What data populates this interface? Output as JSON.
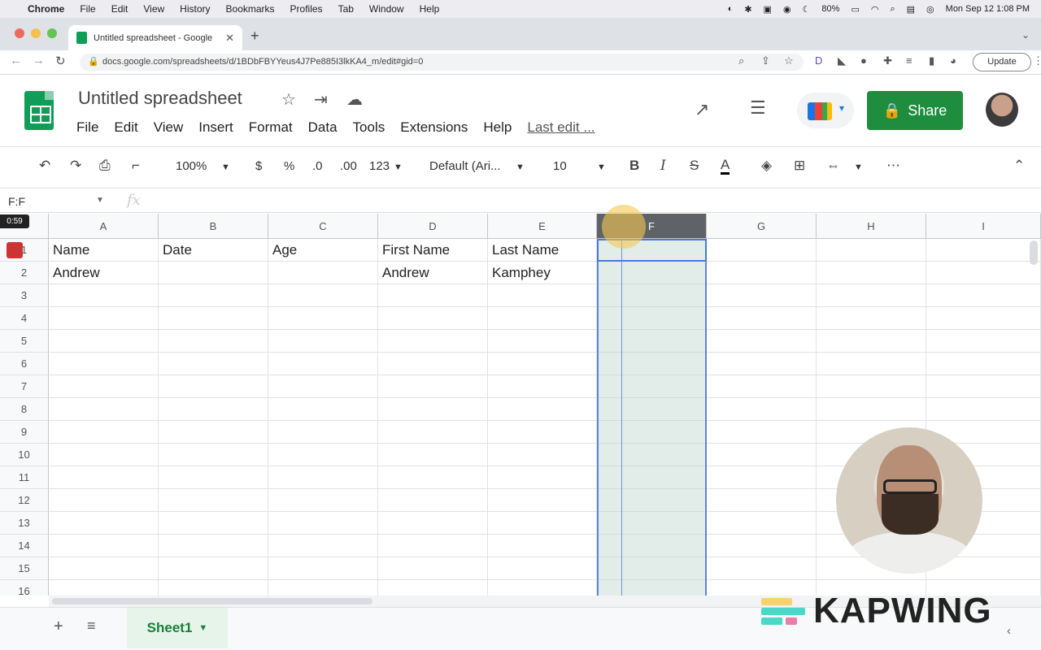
{
  "os_menubar": {
    "apple": "",
    "items": [
      "Chrome",
      "File",
      "Edit",
      "View",
      "History",
      "Bookmarks",
      "Profiles",
      "Tab",
      "Window",
      "Help"
    ],
    "battery": "80%",
    "datetime": "Mon Sep 12  1:08 PM"
  },
  "browser": {
    "tab_title": "Untitled spreadsheet - Google",
    "tab_close": "✕",
    "new_tab": "+",
    "url": "docs.google.com/spreadsheets/d/1BDbFBYYeus4J7Pe885I3lkKA4_m/edit#gid=0",
    "update_label": "Update"
  },
  "doc": {
    "title": "Untitled spreadsheet",
    "menus": [
      "File",
      "Edit",
      "View",
      "Insert",
      "Format",
      "Data",
      "Tools",
      "Extensions",
      "Help"
    ],
    "last_edit": "Last edit ...",
    "share_label": "Share"
  },
  "toolbar": {
    "zoom": "100%",
    "currency": "$",
    "percent": "%",
    "dec_decrease": ".0",
    "dec_increase": ".00",
    "number_format": "123",
    "font": "Default (Ari...",
    "font_size": "10",
    "bold": "B",
    "italic": "I",
    "strike": "S",
    "text_color": "A",
    "more": "⋯"
  },
  "formula_bar": {
    "name_box": "F:F",
    "fx": "fx",
    "value": ""
  },
  "grid": {
    "columns": [
      "A",
      "B",
      "C",
      "D",
      "E",
      "F",
      "G",
      "H",
      "I"
    ],
    "selected_column": "F",
    "rows": [
      "1",
      "2",
      "3",
      "4",
      "5",
      "6",
      "7",
      "8",
      "9",
      "10",
      "11",
      "12",
      "13",
      "14",
      "15",
      "16"
    ],
    "cells": [
      [
        "Name",
        "Date",
        "Age",
        "First Name",
        "Last Name",
        "",
        "",
        "",
        ""
      ],
      [
        "Andrew",
        "",
        "",
        "Andrew",
        "Kamphey",
        "",
        "",
        "",
        ""
      ]
    ]
  },
  "recording": {
    "timer": "0:59"
  },
  "sheets": {
    "add": "+",
    "list": "≡",
    "tabs": [
      "Sheet1"
    ]
  },
  "watermark": {
    "text": "KAPWING"
  },
  "colors": {
    "share_green": "#1e8e3e",
    "sheet_tab_green": "#188038",
    "selection_blue": "#4a78d8"
  }
}
